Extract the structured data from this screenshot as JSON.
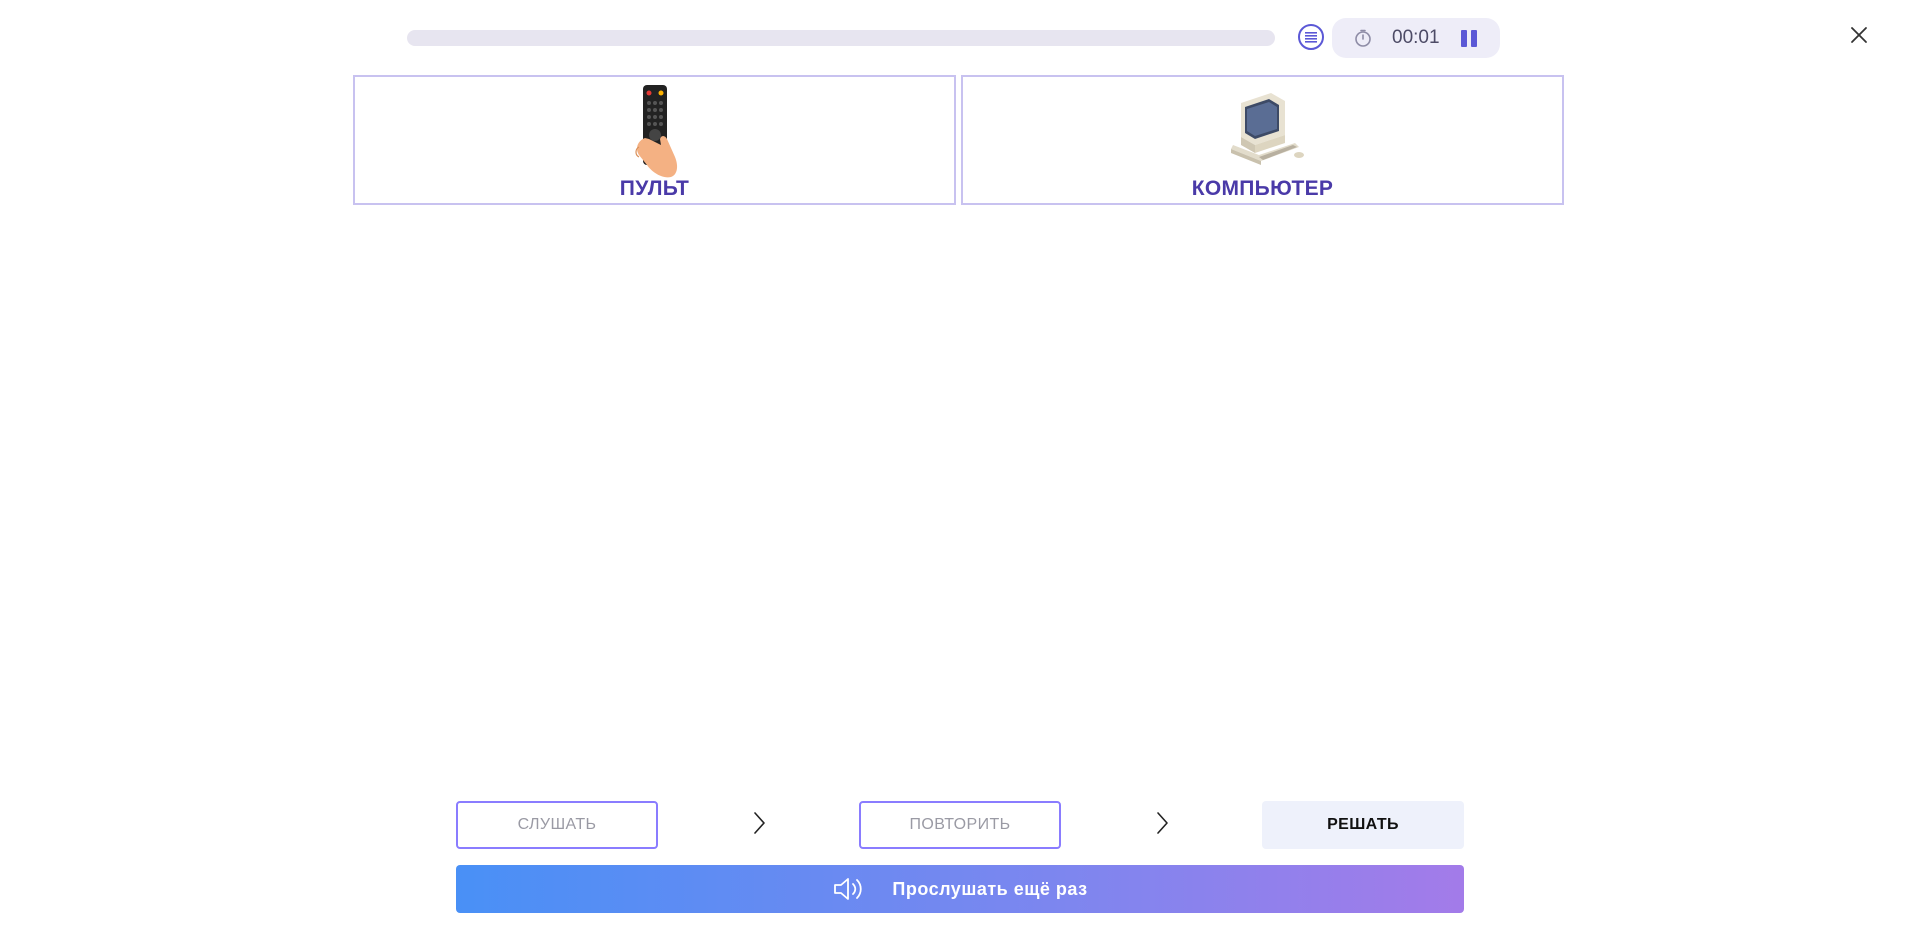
{
  "header": {
    "progress_fraction": 0.0,
    "timer": "00:01",
    "icons": {
      "list": "list-icon",
      "stopwatch": "stopwatch-icon",
      "pause": "pause-icon",
      "close": "close-icon"
    }
  },
  "cards": [
    {
      "label": "ПУЛЬТ",
      "image": "remote-control-in-hand"
    },
    {
      "label": "КОМПЬЮТЕР",
      "image": "desktop-computer"
    }
  ],
  "steps": {
    "listen": "СЛУШАТЬ",
    "repeat": "ПОВТОРИТЬ",
    "solve": "РЕШАТЬ"
  },
  "replay": {
    "label": "Прослушать ещё раз",
    "icon": "speaker-icon"
  },
  "colors": {
    "accent": "#5b58d6",
    "card_border": "#c8c2f0",
    "card_label": "#4a3aa8",
    "gradient_start": "#4990f6",
    "gradient_end": "#a37be9"
  }
}
